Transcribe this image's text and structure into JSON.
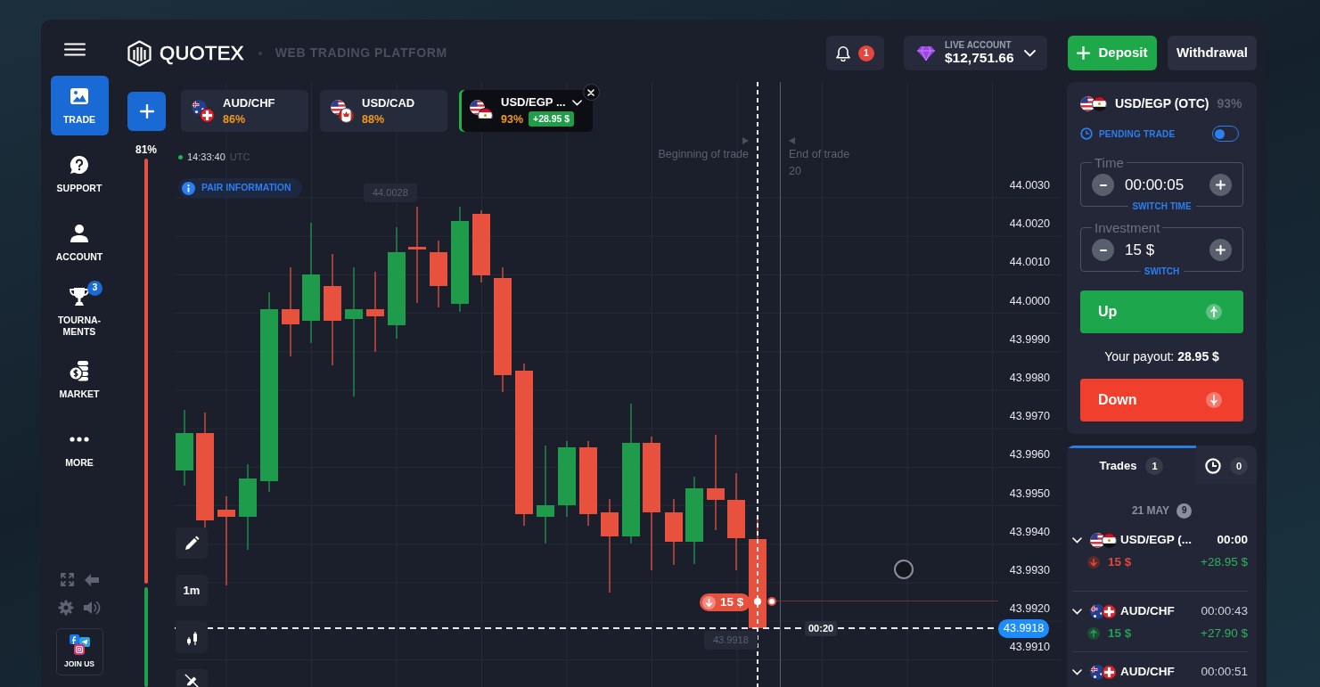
{
  "header": {
    "logo": "QUOTEX",
    "tagline": "WEB TRADING PLATFORM",
    "notifications": "1",
    "account": {
      "label": "LIVE ACCOUNT",
      "balance": "$12,751.66"
    },
    "buttons": [
      {
        "kind": "deposit",
        "label": "Deposit"
      },
      {
        "kind": "withdrawal",
        "label": "Withdrawal"
      }
    ]
  },
  "sidebar": {
    "items": [
      {
        "label": "TRADE",
        "selected": true
      },
      {
        "label": "SUPPORT",
        "selected": false
      },
      {
        "label": "ACCOUNT",
        "selected": false
      },
      {
        "label": "TOURNA-\nMENTS",
        "selected": false,
        "badge": "3"
      },
      {
        "label": "MARKET",
        "selected": false
      },
      {
        "label": "MORE",
        "selected": false
      }
    ],
    "join_us": "JOIN US"
  },
  "asset_tabs": [
    {
      "kind": "au-ch",
      "pair": "AUD/CHF",
      "payout": "86%",
      "selected": false
    },
    {
      "kind": "us-ca",
      "pair": "USD/CAD",
      "payout": "88%",
      "selected": false
    },
    {
      "kind": "us-eg",
      "pair": "USD/EGP ...",
      "payout": "93%",
      "profit": "+28.95 $",
      "selected": true
    }
  ],
  "sentiment": {
    "reading": "81%",
    "level": 0.81
  },
  "chart": {
    "clock": "14:33:40",
    "timezone": "UTC",
    "pair_info": "PAIR INFORMATION",
    "high_label": "44.0028",
    "trade_start": "Beginning of trade",
    "trade_end": "End of trade",
    "trade_end_seconds": "20",
    "price_scale": [
      "44.0030",
      "44.0020",
      "44.0010",
      "44.0000",
      "43.9990",
      "43.9980",
      "43.9970",
      "43.9960",
      "43.9950",
      "43.9940",
      "43.9930",
      "43.9920",
      "43.9910"
    ],
    "current_price": "43.9918",
    "cursor_price": "43.9918",
    "countdown": "00:20",
    "trade_marker": {
      "up": false,
      "amount": "15 $"
    },
    "timeframe": "1m"
  },
  "trade_panel": {
    "kind": "us-eg",
    "pair": "USD/EGP (OTC)",
    "payout": "93%",
    "pending_trade": {
      "label": "PENDING TRADE",
      "on": false
    },
    "time": {
      "label": "Time",
      "value": "00:00:05",
      "switch": "SWITCH TIME"
    },
    "investment": {
      "label": "Investment",
      "value": "15 $",
      "switch": "SWITCH"
    },
    "up_button": "Up",
    "payout_text": "Your payout: **28.95 $**",
    "down_button": "Down"
  },
  "trades": {
    "tabs": [
      {
        "kind": "trades",
        "label": "Trades",
        "count": "1",
        "selected": true
      },
      {
        "kind": "pending",
        "count": "0",
        "selected": false
      }
    ],
    "date": "21 MAY",
    "date_count": "9",
    "items": [
      {
        "kind": "us-eg",
        "pair": "USD/EGP (...",
        "time": "00:00",
        "active": true,
        "up": false,
        "amount": "15 $",
        "profit": "+28.95 $"
      },
      {
        "kind": "au-ch",
        "pair": "AUD/CHF",
        "time": "00:00:43",
        "active": false,
        "up": true,
        "amount": "15 $",
        "profit": "+27.90 $"
      },
      {
        "kind": "au-ch",
        "pair": "AUD/CHF",
        "time": "00:00:51",
        "active": false
      }
    ]
  }
}
